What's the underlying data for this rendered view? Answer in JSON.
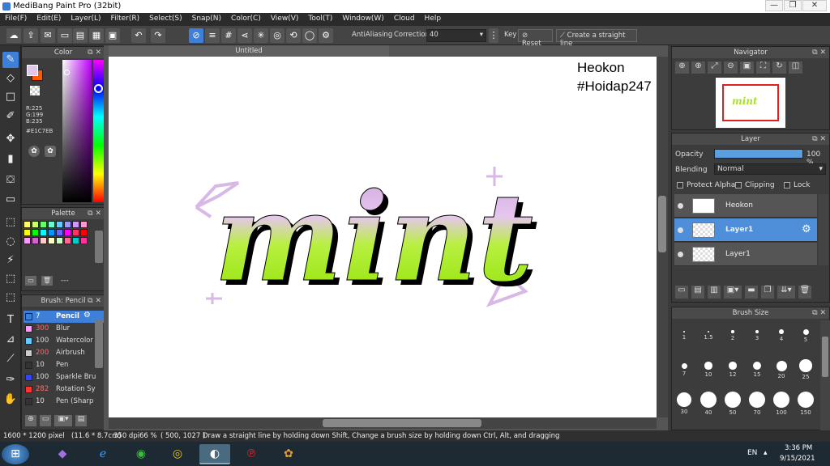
{
  "window": {
    "title": "MediBang Paint Pro (32bit)"
  },
  "menu": [
    "File(F)",
    "Edit(E)",
    "Layer(L)",
    "Filter(R)",
    "Select(S)",
    "Snap(N)",
    "Color(C)",
    "View(V)",
    "Tool(T)",
    "Window(W)",
    "Cloud",
    "Help"
  ],
  "toolbar": {
    "antialiasing_label": "AntiAliasing",
    "correction_label": "Correction",
    "correction_value": "40",
    "key_label": "Key",
    "reset_label": "Reset",
    "straight_line_label": "Create a straight line"
  },
  "color_panel": {
    "title": "Color",
    "r": "R:225",
    "g": "G:199",
    "b": "B:235",
    "hex": "#E1C7EB",
    "main_color": "#e1c7eb",
    "accent": "#3d7fd9"
  },
  "palette_panel": {
    "title": "Palette",
    "footer_text": "---",
    "swatches": [
      "#ffff66",
      "#ccff66",
      "#66ff66",
      "#66ffcc",
      "#66ccff",
      "#9999ff",
      "#cc99ff",
      "#ff99cc",
      "#ff9966",
      "#ffcc66",
      "#ffff00",
      "#00ff00",
      "#00ffff",
      "#0099ff",
      "#6666ff",
      "#ff00ff",
      "#ff3366",
      "#ff0000",
      "#ff9900",
      "#ffcc00",
      "#ff99ff",
      "#cc66cc",
      "#ffcccc",
      "#ffffcc",
      "#ccffcc",
      "#ff6699",
      "#00cccc",
      "#ff3399"
    ]
  },
  "brush_panel": {
    "title": "Brush: Pencil",
    "brushes": [
      {
        "size": "7",
        "name": "Pencil",
        "color": "#3d7fd9",
        "selected": true
      },
      {
        "size": "300",
        "name": "Blur",
        "color": "#ff99ff"
      },
      {
        "size": "100",
        "name": "Watercolor",
        "color": "#66ccff"
      },
      {
        "size": "200",
        "name": "Airbrush",
        "color": "#cccccc"
      },
      {
        "size": "10",
        "name": "Pen",
        "color": "#333333"
      },
      {
        "size": "100",
        "name": "Sparkle Bru",
        "color": "#3344ff"
      },
      {
        "size": "282",
        "name": "Rotation Sy",
        "color": "#ff3333"
      },
      {
        "size": "10",
        "name": "Pen (Sharp",
        "color": "#333333"
      }
    ]
  },
  "document": {
    "tab": "Untitled",
    "watermark_line1": "Heokon",
    "watermark_line2": "#Hoidap247",
    "artwork_text": "mint"
  },
  "navigator": {
    "title": "Navigator",
    "thumb_text": "mint"
  },
  "layer_panel": {
    "title": "Layer",
    "opacity_label": "Opacity",
    "opacity_value": "100 %",
    "opacity_fraction": 1.0,
    "blending_label": "Blending",
    "blending_value": "Normal",
    "protect_alpha": "Protect Alpha",
    "clipping": "Clipping",
    "lock": "Lock",
    "layers": [
      {
        "name": "Heokon"
      },
      {
        "name": "Layer1",
        "selected": true
      },
      {
        "name": "Layer1"
      }
    ]
  },
  "brush_size_panel": {
    "title": "Brush Size",
    "sizes": [
      "1",
      "1.5",
      "2",
      "3",
      "4",
      "5",
      "7",
      "10",
      "12",
      "15",
      "20",
      "25",
      "30",
      "40",
      "50",
      "70",
      "100",
      "150"
    ]
  },
  "status": {
    "dimensions": "1600 * 1200 pixel",
    "physical": "(11.6 * 8.7cm)",
    "dpi": "350 dpi",
    "zoom": "66 %",
    "coords": "( 500, 1027 )",
    "hint": "Draw a straight line by holding down Shift, Change a brush size by holding down Ctrl, Alt, and dragging"
  },
  "taskbar": {
    "lang": "EN",
    "time": "3:36 PM",
    "date": "9/15/2021"
  }
}
